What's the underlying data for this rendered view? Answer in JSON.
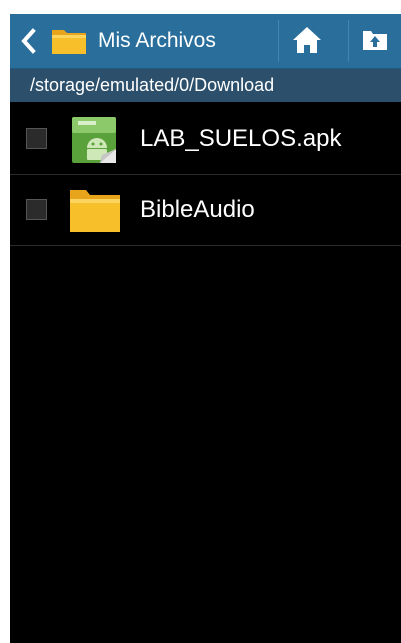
{
  "actionbar": {
    "title": "Mis Archivos",
    "back_icon": "chevron-left-icon",
    "folder_icon": "folder-icon",
    "home_icon": "home-icon",
    "up_icon": "folder-up-icon",
    "color": "#2a6f9c"
  },
  "pathbar": {
    "path": "/storage/emulated/0/Download",
    "color": "#2c4f6b"
  },
  "files": [
    {
      "name": "LAB_SUELOS.apk",
      "icon": "android-apk-icon",
      "checked": false
    },
    {
      "name": "BibleAudio",
      "icon": "folder-icon",
      "checked": false
    }
  ]
}
